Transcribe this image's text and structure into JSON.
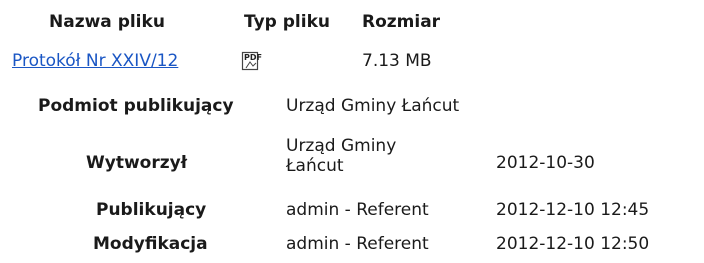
{
  "files_table": {
    "headers": {
      "name": "Nazwa pliku",
      "type": "Typ pliku",
      "size": "Rozmiar"
    },
    "rows": [
      {
        "name": "Protokół Nr XXIV/12",
        "type_icon": "pdf-file-icon",
        "type_icon_text": "PDF",
        "size": "7.13 MB"
      }
    ]
  },
  "metadata": {
    "publisher": {
      "label": "Podmiot publikujący",
      "value": "Urząd Gminy Łańcut"
    },
    "created": {
      "label": "Wytworzył",
      "value_line1": "Urząd Gminy",
      "value_line2": "Łańcut",
      "date": "2012-10-30"
    },
    "published": {
      "label": "Publikujący",
      "value": "admin - Referent",
      "date": "2012-12-10 12:45"
    },
    "modified": {
      "label": "Modyfikacja",
      "value": "admin - Referent",
      "date": "2012-12-10 12:50"
    }
  }
}
